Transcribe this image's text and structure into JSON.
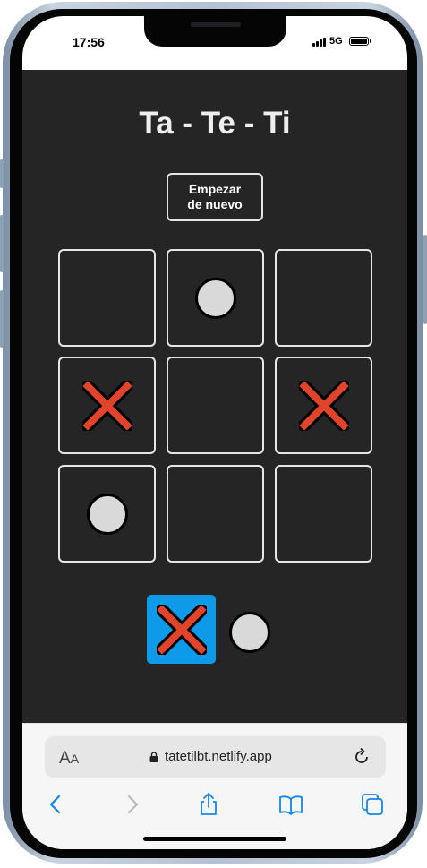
{
  "status": {
    "time": "17:56",
    "network": "5G"
  },
  "game": {
    "title": "Ta - Te - Ti",
    "reset_label_line1": "Empezar",
    "reset_label_line2": "de nuevo",
    "board": [
      "",
      "O",
      "",
      "X",
      "",
      "X",
      "O",
      "",
      ""
    ],
    "turn": {
      "current": "X",
      "options": [
        "X",
        "O"
      ],
      "active_color": "#0d9be9"
    },
    "colors": {
      "background": "#252525",
      "x_mark": "#e0442a",
      "o_mark": "#d9d9d9"
    }
  },
  "browser": {
    "aa_label_big": "A",
    "aa_label_small": "A",
    "url": "tatetilbt.netlify.app",
    "icons": [
      "lock-icon",
      "reload-icon",
      "back-icon",
      "forward-icon",
      "share-icon",
      "bookmarks-icon",
      "tabs-icon"
    ]
  }
}
